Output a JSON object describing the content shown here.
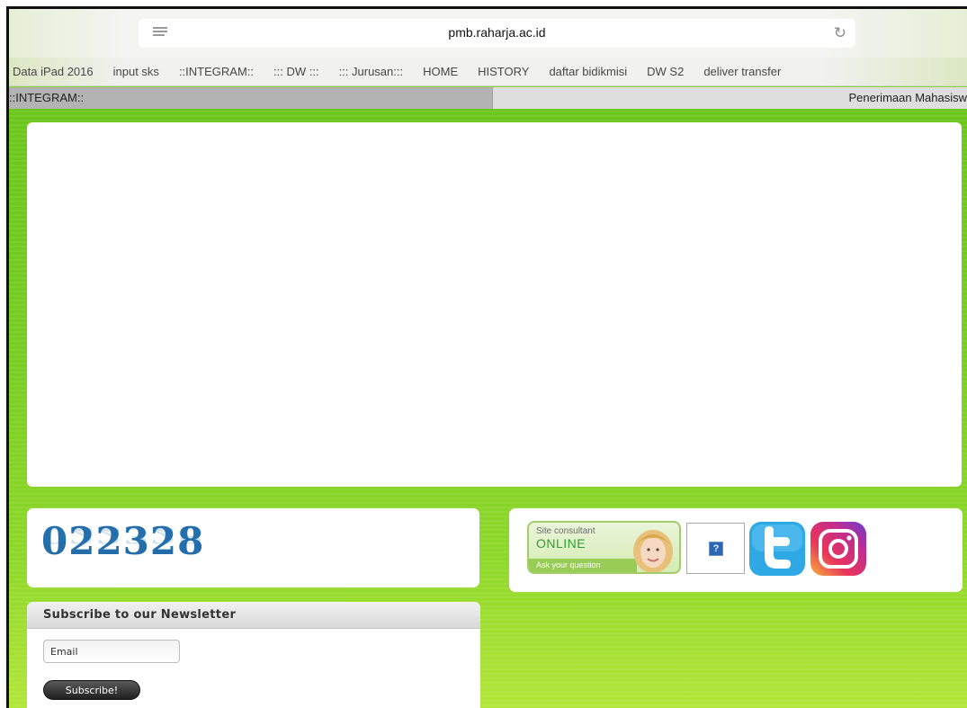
{
  "browser": {
    "url": "pmb.raharja.ac.id",
    "reader_icon": "reader-icon",
    "reload_icon": "reload-icon"
  },
  "bookmarks": [
    {
      "label": "Data iPad 2016"
    },
    {
      "label": "input sks"
    },
    {
      "label": "::INTEGRAM::"
    },
    {
      "label": "::: DW :::"
    },
    {
      "label": "::: Jurusan:::"
    },
    {
      "label": "HOME"
    },
    {
      "label": "HISTORY"
    },
    {
      "label": "daftar bidikmisi"
    },
    {
      "label": "DW S2"
    },
    {
      "label": "deliver transfer"
    }
  ],
  "tabs": [
    {
      "label": "::INTEGRAM::",
      "active": true
    },
    {
      "label": "Penerimaan Mahasisw",
      "active": false
    }
  ],
  "counter": {
    "value": "022328"
  },
  "consultant": {
    "small_text": "Site consultant",
    "status": "ONLINE",
    "cta": "Ask your question"
  },
  "help": {
    "glyph": "?"
  },
  "social": {
    "twitter_icon": "twitter-icon",
    "instagram_icon": "instagram-icon"
  },
  "newsletter": {
    "title": "Subscribe to our Newsletter",
    "email_value": "Email",
    "subscribe_label": "Subscribe!"
  },
  "colors": {
    "page_green": "#7acd22",
    "counter_blue": "#236eaa",
    "twitter_blue": "#2fa9e6"
  }
}
